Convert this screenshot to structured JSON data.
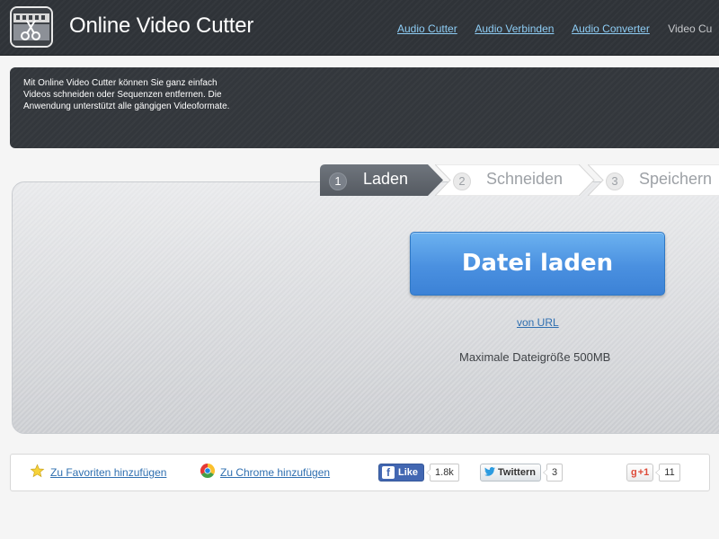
{
  "header": {
    "title": "Online Video Cutter",
    "nav": [
      "Audio Cutter",
      "Audio Verbinden",
      "Audio Converter"
    ],
    "current": "Video Cu"
  },
  "intro": {
    "text": "Mit Online Video Cutter können Sie ganz einfach Videos schneiden oder Sequenzen entfernen. Die Anwendung unterstützt alle gängigen Videoformate."
  },
  "steps": [
    {
      "num": "1",
      "label": "Laden",
      "state": "active"
    },
    {
      "num": "2",
      "label": "Schneiden",
      "state": "inactive"
    },
    {
      "num": "3",
      "label": "Speichern",
      "state": "inactive"
    }
  ],
  "main": {
    "upload_label": "Datei laden",
    "url_link": "von URL",
    "max_size": "Maximale Dateigröße 500MB"
  },
  "share": {
    "favorites_label": "Zu Favoriten hinzufügen",
    "chrome_label": "Zu Chrome hinzufügen",
    "facebook_label": "Like",
    "facebook_count": "1.8k",
    "twitter_label": "Twittern",
    "twitter_count": "3",
    "gplus_label": "+1",
    "gplus_count": "11"
  },
  "colors": {
    "header_bg": "#2f3338",
    "accent_blue": "#4a90e0",
    "link": "#2f6fb0",
    "nav_link": "#8ecdf5"
  }
}
